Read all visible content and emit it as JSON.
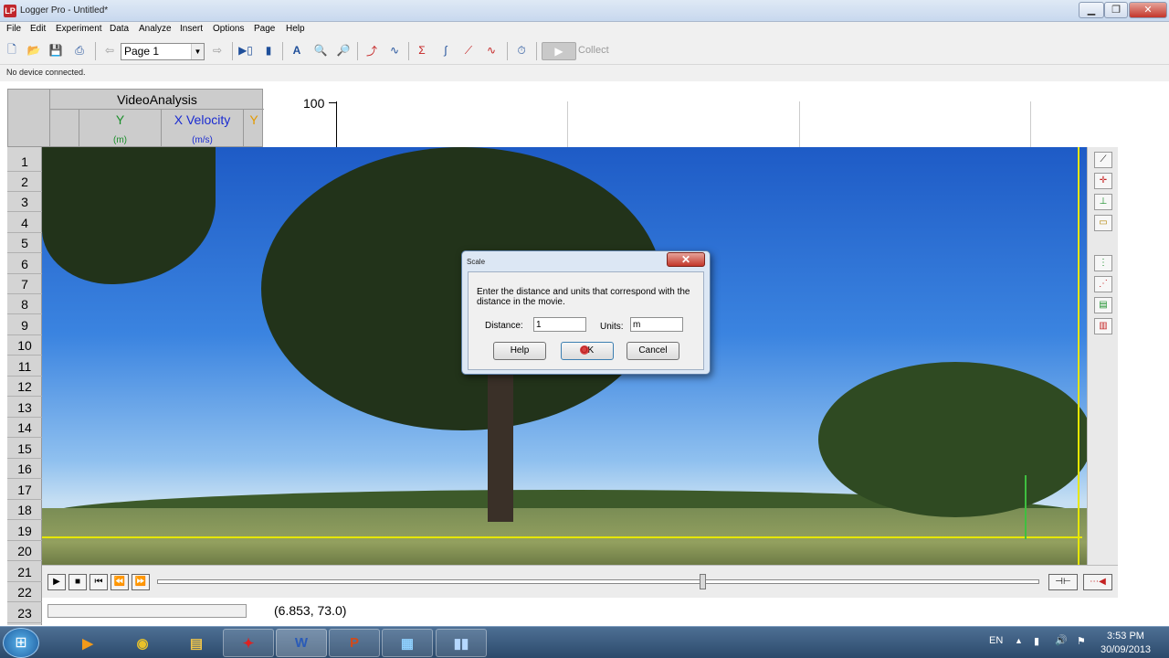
{
  "window": {
    "title": "Logger Pro - Untitled*",
    "logo": "LP",
    "buttons": [
      "▁",
      "❐",
      "✕"
    ]
  },
  "menu": [
    "File",
    "Edit",
    "Experiment",
    "Data",
    "Analyze",
    "Insert",
    "Options",
    "Page",
    "Help"
  ],
  "toolbar": {
    "page": "Page 1",
    "collect": "Collect"
  },
  "status": "No device connected.",
  "table": {
    "title": "VideoAnalysis",
    "columns": [
      {
        "name": "Y",
        "unit": "(m)",
        "color": "#1a8f2a"
      },
      {
        "name": "X Velocity",
        "unit": "(m/s)",
        "color": "#1a2bd1"
      },
      {
        "name": "Y",
        "unit": "",
        "color": "#e39a00"
      }
    ],
    "rows": [
      "1",
      "2",
      "3",
      "4",
      "5",
      "6",
      "7",
      "8",
      "9",
      "10",
      "11",
      "12",
      "13",
      "14",
      "15",
      "16",
      "17",
      "18",
      "19",
      "20",
      "21",
      "22",
      "23"
    ]
  },
  "graph": {
    "y_tick": "100"
  },
  "dialog": {
    "title": "Scale",
    "message": "Enter the distance and units that correspond with the distance in the movie.",
    "distance_label": "Distance:",
    "distance_value": "1",
    "units_label": "Units:",
    "units_value": "m",
    "help": "Help",
    "ok": "OK",
    "cancel": "Cancel"
  },
  "coordinates": "(6.853, 73.0)",
  "taskbar": {
    "apps": [
      "media-player",
      "chrome",
      "explorer",
      "logger-pro",
      "word",
      "powerpoint",
      "control-panel",
      "video"
    ],
    "lang": "EN",
    "time": "3:53 PM",
    "date": "30/09/2013"
  }
}
